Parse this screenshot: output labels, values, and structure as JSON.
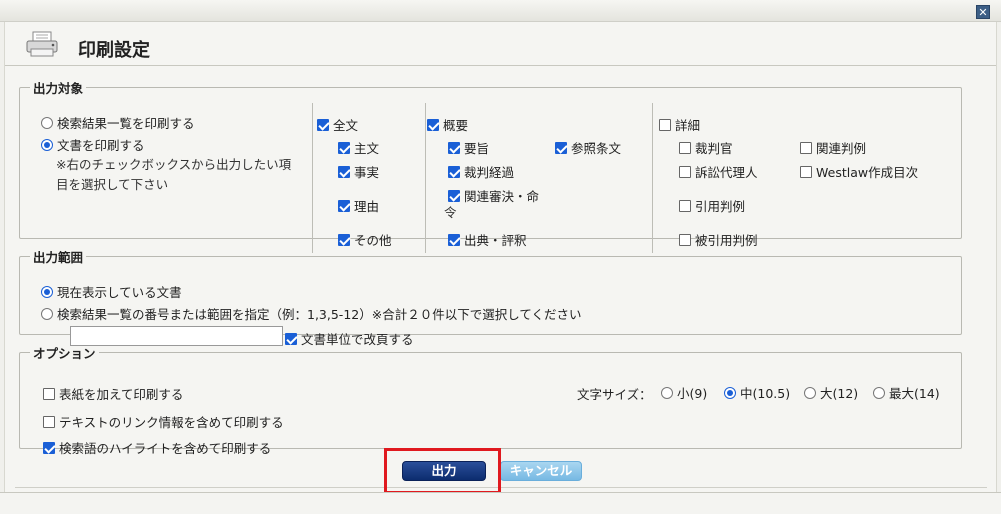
{
  "window": {
    "close_glyph": "✕"
  },
  "header": {
    "title": "印刷設定",
    "icon": "printer-icon"
  },
  "target_section": {
    "legend": "出力対象",
    "option_list": "検索結果一覧を印刷する",
    "option_document": "文書を印刷する",
    "note_line1": "※右のチェックボックスから出力したい項",
    "note_line2": "目を選択して下さい",
    "col_full": {
      "header": "全文",
      "items": [
        "主文",
        "事実",
        "理由",
        "その他"
      ]
    },
    "col_summary": {
      "header": "概要",
      "items": [
        "要旨",
        "裁判経過",
        "関連審決・命",
        "令",
        "出典・評釈",
        "参照条文"
      ]
    },
    "col_detail": {
      "header": "詳細",
      "items": [
        "裁判官",
        "訴訟代理人",
        "引用判例",
        "被引用判例",
        "関連判例",
        "Westlaw作成目次"
      ]
    }
  },
  "range_section": {
    "legend": "出力範囲",
    "option_current": "現在表示している文書",
    "option_numbers": "検索結果一覧の番号または範囲を指定（例：1,3,5-12）※合計２０件以下で選択してください",
    "range_input_value": "",
    "page_break_label": "文書単位で改頁する"
  },
  "options_section": {
    "legend": "オプション",
    "cover_label": "表紙を加えて印刷する",
    "link_label": "テキストのリンク情報を含めて印刷する",
    "highlight_label": "検索語のハイライトを含めて印刷する",
    "font_size_label": "文字サイズ：",
    "font_small": "小(9)",
    "font_medium": "中(10.5)",
    "font_large": "大(12)",
    "font_max": "最大(14)"
  },
  "buttons": {
    "output": "出力",
    "cancel": "キャンセル"
  },
  "colors": {
    "accent": "#1a5fd6",
    "output_button": "#0c2c6e",
    "cancel_button": "#77b9e3",
    "highlight": "#e0191f"
  }
}
